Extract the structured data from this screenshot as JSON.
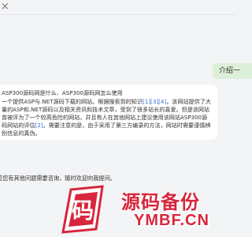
{
  "colors": {
    "background": "#f3f4f6",
    "user_bubble": "#dcefd8",
    "bot_bubble": "#ffffff",
    "citation": "#2f6fe0",
    "watermark": "#d7263d"
  },
  "window": {
    "close_icon": "close-icon",
    "close_glyph": "×"
  },
  "chat": {
    "user_message": "介绍一",
    "bot_message": {
      "title": "ASP300源码网是什么、ASP300源码网怎么使用",
      "segments": [
        {
          "text": "一个提供ASP与.NET源码下载的网站。根据搜索到的知识",
          "cite": false
        },
        {
          "text": "[1]",
          "cite": true
        },
        {
          "text": "[3]",
          "cite": true
        },
        {
          "text": "[4]",
          "cite": true
        },
        {
          "text": "，该网站提供了大量的ASP和.NET源码以及相关资讯和技术文章，受到了很多站长的喜爱。但是该网站曾被评为了一个较高危险的网站，并且有人在其他网站上建议使用该网站ASP300源码网站的评估",
          "cite": false
        },
        {
          "text": "[2]",
          "cite": true
        },
        {
          "text": "。需要注意的是，由于采用了第三方编录的方法，网站时需要谨慎辨别信息的真伪。",
          "cite": false
        }
      ]
    },
    "followup": "若您有其他问题需要咨询，随时欢迎向我提问。"
  },
  "watermark": {
    "logo_glyph": "码",
    "title": "源码备份",
    "domain": "YMBF.CN"
  }
}
